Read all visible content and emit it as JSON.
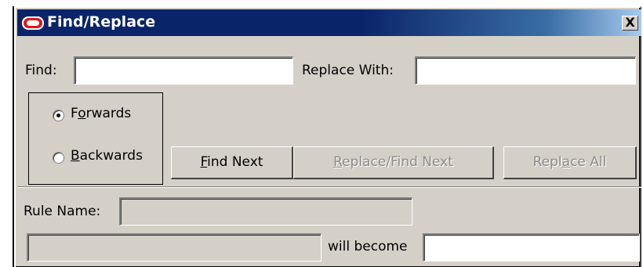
{
  "window": {
    "title": "Find/Replace",
    "close_glyph": "X",
    "logo_icon": "oracle-logo-icon"
  },
  "find": {
    "label": "Find:",
    "value": ""
  },
  "replace": {
    "label": "Replace With:",
    "value": ""
  },
  "direction": {
    "forwards": {
      "label_pre": "F",
      "label_underline": "o",
      "label_post": "rwards",
      "checked": true
    },
    "backwards": {
      "label_pre": "",
      "label_underline": "B",
      "label_post": "ackwards",
      "checked": false
    }
  },
  "buttons": {
    "find_next": {
      "underline": "F",
      "rest": "ind Next",
      "enabled": true
    },
    "replace_find_next": {
      "underline": "R",
      "rest": "eplace/Find Next",
      "enabled": false
    },
    "replace_all": {
      "pre": "Repl",
      "underline": "a",
      "post": "ce All",
      "enabled": false
    }
  },
  "rule": {
    "label": "Rule Name:",
    "value": ""
  },
  "transform": {
    "from_value": "",
    "middle_label": "will become",
    "to_value": ""
  }
}
